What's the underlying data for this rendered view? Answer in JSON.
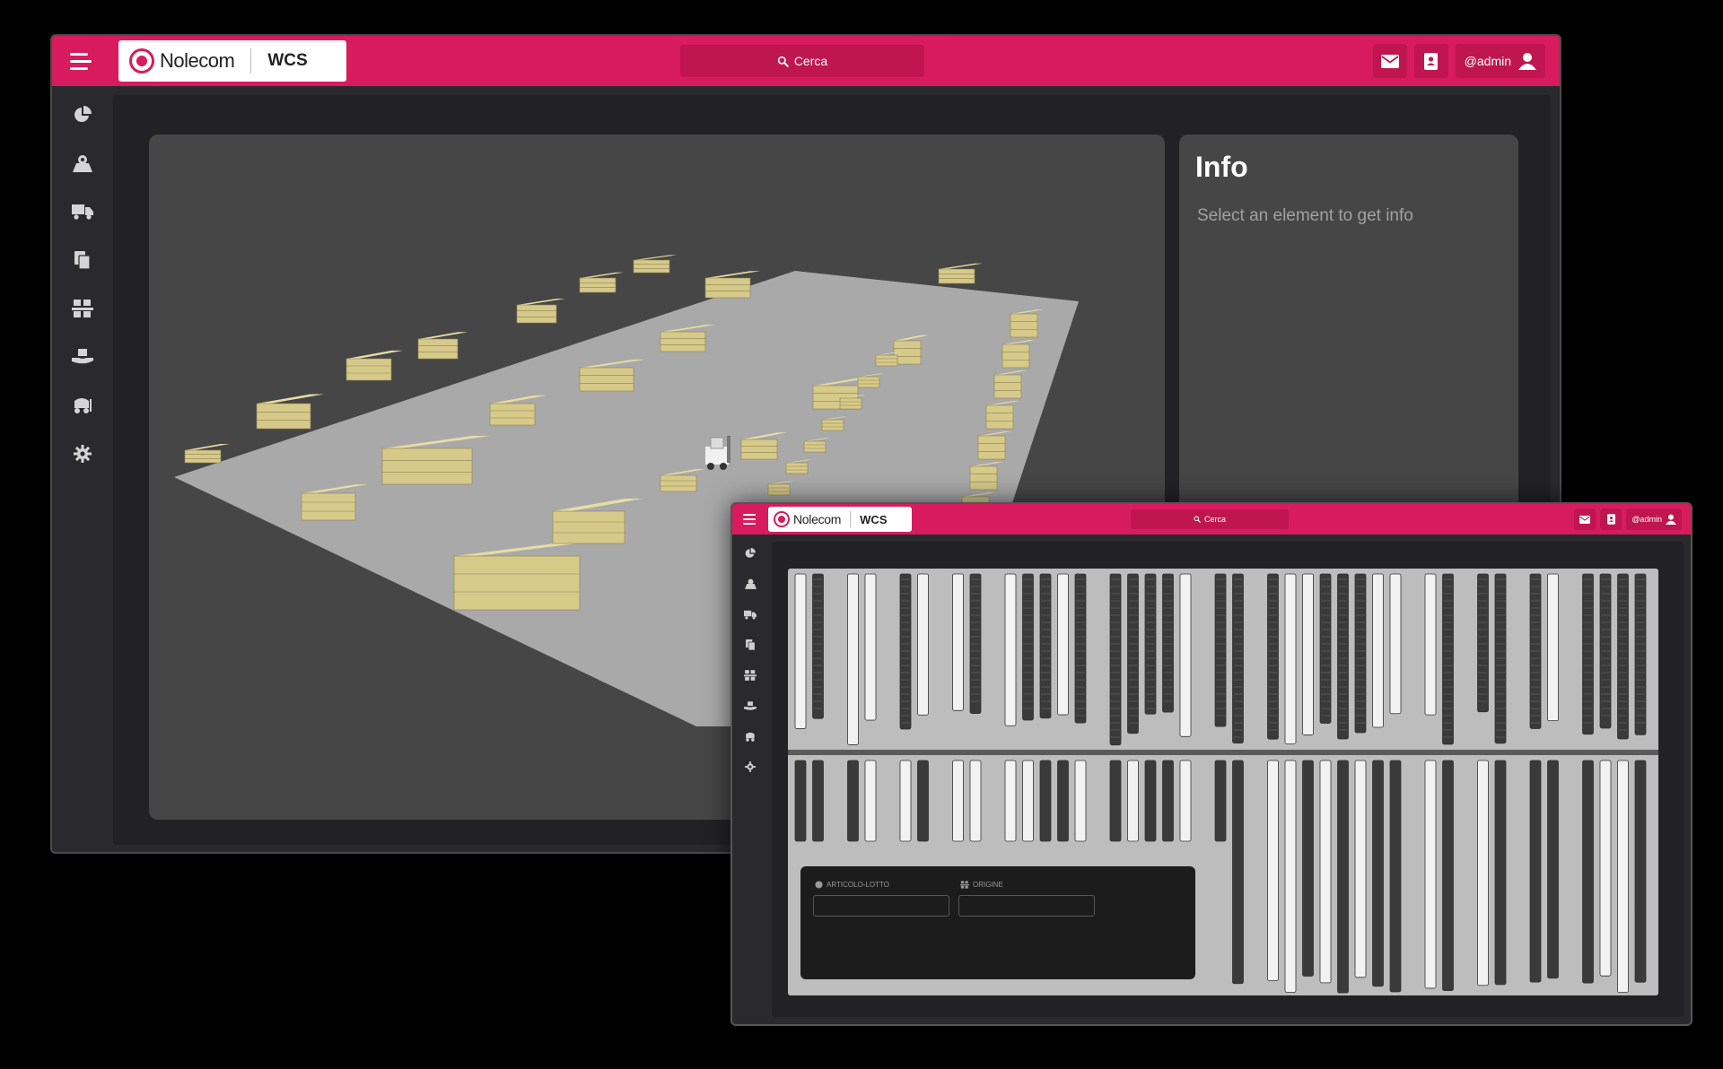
{
  "main_window": {
    "logo": {
      "brand": "Nolecom",
      "app": "WCS"
    },
    "search": {
      "label": "Cerca"
    },
    "user": {
      "name": "@admin"
    },
    "sidebar": {
      "items": [
        {
          "icon": "pie-chart-icon"
        },
        {
          "icon": "map-location-icon"
        },
        {
          "icon": "truck-icon"
        },
        {
          "icon": "documents-icon"
        },
        {
          "icon": "warehouse-icon"
        },
        {
          "icon": "hand-holding-icon"
        },
        {
          "icon": "forklift-icon"
        },
        {
          "icon": "gear-icon"
        }
      ]
    },
    "info_panel": {
      "title": "Info",
      "hint": "Select an element to get info"
    }
  },
  "sub_window": {
    "logo": {
      "brand": "Nolecom",
      "app": "WCS"
    },
    "search": {
      "label": "Cerca"
    },
    "user": {
      "name": "@admin"
    },
    "filters": {
      "article_label": "ARTICOLO-LOTTO",
      "origin_label": "ORIGINE"
    }
  },
  "colors": {
    "accent": "#d81b5c",
    "accent_dark": "#c01650",
    "shelf": "#d6c98a",
    "floor": "#a9a9a9",
    "panel": "#464646"
  }
}
